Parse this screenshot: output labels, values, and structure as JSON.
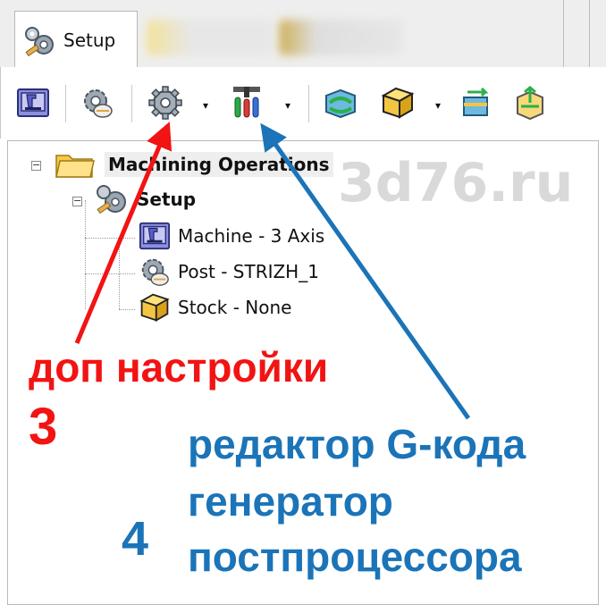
{
  "tabs": [
    {
      "label": "Setup",
      "icon": "setup-gears-icon",
      "state": "active"
    }
  ],
  "toolbar": {
    "buttons": [
      {
        "name": "machine-button",
        "icon": "machine-icon"
      },
      {
        "name": "post-button",
        "icon": "post-gear-icon"
      },
      {
        "name": "additional-settings-button",
        "icon": "gear-icon",
        "has_dropdown": true
      },
      {
        "name": "gcode-editor-button",
        "icon": "tools-icon",
        "has_dropdown": true
      },
      {
        "name": "stock-update-button",
        "icon": "stock-update-icon"
      },
      {
        "name": "stock-button",
        "icon": "stock-cube-icon",
        "has_dropdown": true
      },
      {
        "name": "stock-transform-button",
        "icon": "stock-transform-icon"
      },
      {
        "name": "stock-resize-button",
        "icon": "stock-resize-icon"
      }
    ],
    "dropdown_glyph": "▾"
  },
  "tree": {
    "root": {
      "label": "Machining Operations",
      "expander": "−"
    },
    "setup": {
      "label": "Setup",
      "expander": "−"
    },
    "items": [
      {
        "label": "Machine - 3 Axis",
        "icon": "machine-icon"
      },
      {
        "label": "Post - STRIZH_1",
        "icon": "post-gear-icon"
      },
      {
        "label": "Stock - None",
        "icon": "stock-cube-icon"
      }
    ]
  },
  "watermark": "3d76.ru",
  "annotations": {
    "red_label": "доп настройки",
    "red_number": "3",
    "blue_lines": [
      "редактор G-кода",
      "генератор",
      "постпроцессора"
    ],
    "blue_number": "4"
  },
  "colors": {
    "red": "#f21313",
    "blue": "#1b74b8",
    "watermark": "#d9d9d9"
  }
}
